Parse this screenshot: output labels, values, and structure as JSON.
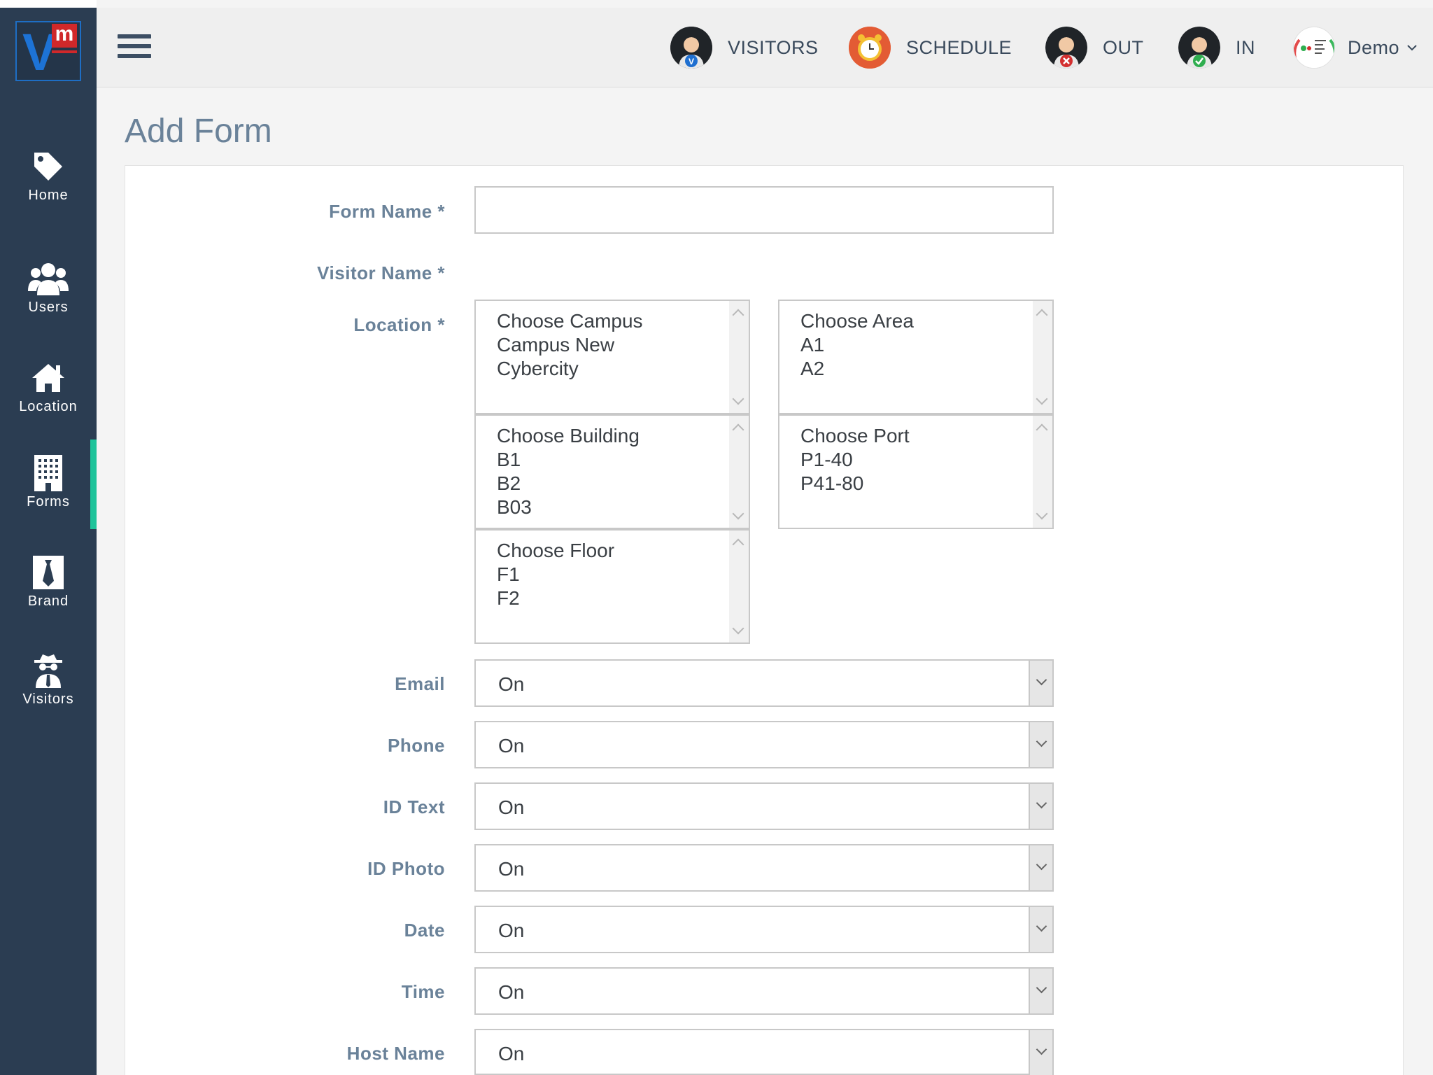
{
  "sidebar": {
    "logo_v": "V",
    "logo_m": "m",
    "items": [
      {
        "label": "Home",
        "icon": "tag-icon"
      },
      {
        "label": "Users",
        "icon": "users-icon"
      },
      {
        "label": "Location",
        "icon": "home-icon"
      },
      {
        "label": "Forms",
        "icon": "building-icon",
        "active": true
      },
      {
        "label": "Brand",
        "icon": "tie-icon"
      },
      {
        "label": "Visitors",
        "icon": "spy-icon"
      }
    ],
    "active_color": "#1ec39a"
  },
  "header": {
    "nav": [
      {
        "label": "VISITORS",
        "icon": "visitor-avatar-icon"
      },
      {
        "label": "SCHEDULE",
        "icon": "alarm-clock-icon"
      },
      {
        "label": "OUT",
        "icon": "visitor-out-avatar-icon"
      },
      {
        "label": "IN",
        "icon": "visitor-in-avatar-icon"
      }
    ],
    "user": {
      "label": "Demo",
      "icon": "chevron-down-icon"
    }
  },
  "page": {
    "title": "Add Form"
  },
  "form": {
    "form_name_label": "Form Name *",
    "form_name_value": "",
    "visitor_name_label": "Visitor Name *",
    "location_label": "Location *",
    "location_lists": {
      "campus": [
        "Choose Campus",
        "Campus New",
        "Cybercity"
      ],
      "area": [
        "Choose Area",
        "A1",
        "A2"
      ],
      "building": [
        "Choose Building",
        "B1",
        "B2",
        "B03"
      ],
      "port": [
        "Choose Port",
        "P1-40",
        "P41-80"
      ],
      "floor": [
        "Choose Floor",
        "F1",
        "F2"
      ]
    },
    "fields": [
      {
        "label": "Email",
        "value": "On"
      },
      {
        "label": "Phone",
        "value": "On"
      },
      {
        "label": "ID Text",
        "value": "On"
      },
      {
        "label": "ID Photo",
        "value": "On"
      },
      {
        "label": "Date",
        "value": "On"
      },
      {
        "label": "Time",
        "value": "On"
      },
      {
        "label": "Host Name",
        "value": "On"
      }
    ]
  }
}
